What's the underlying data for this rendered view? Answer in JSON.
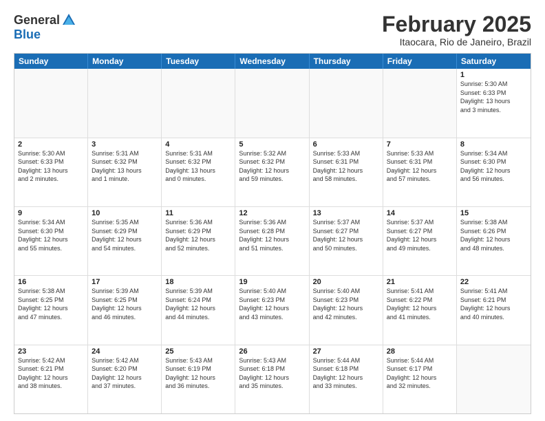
{
  "header": {
    "logo": {
      "general": "General",
      "blue": "Blue",
      "tagline": ""
    },
    "title": "February 2025",
    "location": "Itaocara, Rio de Janeiro, Brazil"
  },
  "weekdays": [
    "Sunday",
    "Monday",
    "Tuesday",
    "Wednesday",
    "Thursday",
    "Friday",
    "Saturday"
  ],
  "rows": [
    [
      {
        "day": "",
        "info": "",
        "empty": true
      },
      {
        "day": "",
        "info": "",
        "empty": true
      },
      {
        "day": "",
        "info": "",
        "empty": true
      },
      {
        "day": "",
        "info": "",
        "empty": true
      },
      {
        "day": "",
        "info": "",
        "empty": true
      },
      {
        "day": "",
        "info": "",
        "empty": true
      },
      {
        "day": "1",
        "info": "Sunrise: 5:30 AM\nSunset: 6:33 PM\nDaylight: 13 hours\nand 3 minutes."
      }
    ],
    [
      {
        "day": "2",
        "info": "Sunrise: 5:30 AM\nSunset: 6:33 PM\nDaylight: 13 hours\nand 2 minutes."
      },
      {
        "day": "3",
        "info": "Sunrise: 5:31 AM\nSunset: 6:32 PM\nDaylight: 13 hours\nand 1 minute."
      },
      {
        "day": "4",
        "info": "Sunrise: 5:31 AM\nSunset: 6:32 PM\nDaylight: 13 hours\nand 0 minutes."
      },
      {
        "day": "5",
        "info": "Sunrise: 5:32 AM\nSunset: 6:32 PM\nDaylight: 12 hours\nand 59 minutes."
      },
      {
        "day": "6",
        "info": "Sunrise: 5:33 AM\nSunset: 6:31 PM\nDaylight: 12 hours\nand 58 minutes."
      },
      {
        "day": "7",
        "info": "Sunrise: 5:33 AM\nSunset: 6:31 PM\nDaylight: 12 hours\nand 57 minutes."
      },
      {
        "day": "8",
        "info": "Sunrise: 5:34 AM\nSunset: 6:30 PM\nDaylight: 12 hours\nand 56 minutes."
      }
    ],
    [
      {
        "day": "9",
        "info": "Sunrise: 5:34 AM\nSunset: 6:30 PM\nDaylight: 12 hours\nand 55 minutes."
      },
      {
        "day": "10",
        "info": "Sunrise: 5:35 AM\nSunset: 6:29 PM\nDaylight: 12 hours\nand 54 minutes."
      },
      {
        "day": "11",
        "info": "Sunrise: 5:36 AM\nSunset: 6:29 PM\nDaylight: 12 hours\nand 52 minutes."
      },
      {
        "day": "12",
        "info": "Sunrise: 5:36 AM\nSunset: 6:28 PM\nDaylight: 12 hours\nand 51 minutes."
      },
      {
        "day": "13",
        "info": "Sunrise: 5:37 AM\nSunset: 6:27 PM\nDaylight: 12 hours\nand 50 minutes."
      },
      {
        "day": "14",
        "info": "Sunrise: 5:37 AM\nSunset: 6:27 PM\nDaylight: 12 hours\nand 49 minutes."
      },
      {
        "day": "15",
        "info": "Sunrise: 5:38 AM\nSunset: 6:26 PM\nDaylight: 12 hours\nand 48 minutes."
      }
    ],
    [
      {
        "day": "16",
        "info": "Sunrise: 5:38 AM\nSunset: 6:25 PM\nDaylight: 12 hours\nand 47 minutes."
      },
      {
        "day": "17",
        "info": "Sunrise: 5:39 AM\nSunset: 6:25 PM\nDaylight: 12 hours\nand 46 minutes."
      },
      {
        "day": "18",
        "info": "Sunrise: 5:39 AM\nSunset: 6:24 PM\nDaylight: 12 hours\nand 44 minutes."
      },
      {
        "day": "19",
        "info": "Sunrise: 5:40 AM\nSunset: 6:23 PM\nDaylight: 12 hours\nand 43 minutes."
      },
      {
        "day": "20",
        "info": "Sunrise: 5:40 AM\nSunset: 6:23 PM\nDaylight: 12 hours\nand 42 minutes."
      },
      {
        "day": "21",
        "info": "Sunrise: 5:41 AM\nSunset: 6:22 PM\nDaylight: 12 hours\nand 41 minutes."
      },
      {
        "day": "22",
        "info": "Sunrise: 5:41 AM\nSunset: 6:21 PM\nDaylight: 12 hours\nand 40 minutes."
      }
    ],
    [
      {
        "day": "23",
        "info": "Sunrise: 5:42 AM\nSunset: 6:21 PM\nDaylight: 12 hours\nand 38 minutes."
      },
      {
        "day": "24",
        "info": "Sunrise: 5:42 AM\nSunset: 6:20 PM\nDaylight: 12 hours\nand 37 minutes."
      },
      {
        "day": "25",
        "info": "Sunrise: 5:43 AM\nSunset: 6:19 PM\nDaylight: 12 hours\nand 36 minutes."
      },
      {
        "day": "26",
        "info": "Sunrise: 5:43 AM\nSunset: 6:18 PM\nDaylight: 12 hours\nand 35 minutes."
      },
      {
        "day": "27",
        "info": "Sunrise: 5:44 AM\nSunset: 6:18 PM\nDaylight: 12 hours\nand 33 minutes."
      },
      {
        "day": "28",
        "info": "Sunrise: 5:44 AM\nSunset: 6:17 PM\nDaylight: 12 hours\nand 32 minutes."
      },
      {
        "day": "",
        "info": "",
        "empty": true
      }
    ]
  ]
}
